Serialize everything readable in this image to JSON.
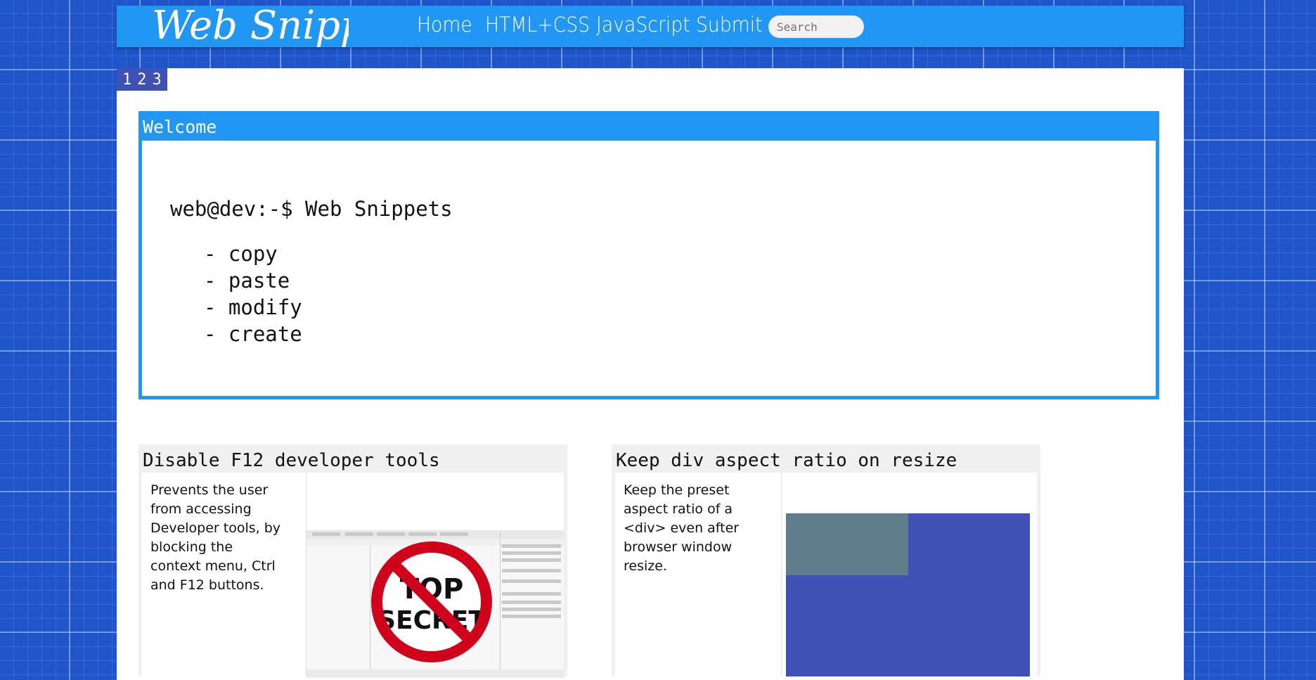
{
  "nav": {
    "logo_text": "Web Snippets",
    "links": [
      "Home",
      "HTML+CSS",
      "JavaScript",
      "Submit"
    ],
    "search_placeholder": "Search"
  },
  "pager": {
    "pages": [
      "1",
      "2",
      "3"
    ]
  },
  "welcome": {
    "title": "Welcome",
    "prompt": "web@dev:-$ Web Snippets",
    "items": [
      "- copy",
      "- paste",
      "- modify",
      "- create"
    ]
  },
  "cards": [
    {
      "title": "Disable F12 developer tools",
      "description": "Prevents the user from accessing Developer tools, by blocking the context menu, Ctrl and F12 buttons.",
      "image_text": "TOP SECRET"
    },
    {
      "title": "Keep div aspect ratio on resize",
      "description": "Keep the preset aspect ratio of a <div> even after browser window resize."
    }
  ],
  "colors": {
    "background": "#1f55c8",
    "navbar": "#2196f3",
    "pager": "#3f51b5",
    "aspect_outer": "#3f51b5",
    "aspect_inner": "#607d8b"
  }
}
